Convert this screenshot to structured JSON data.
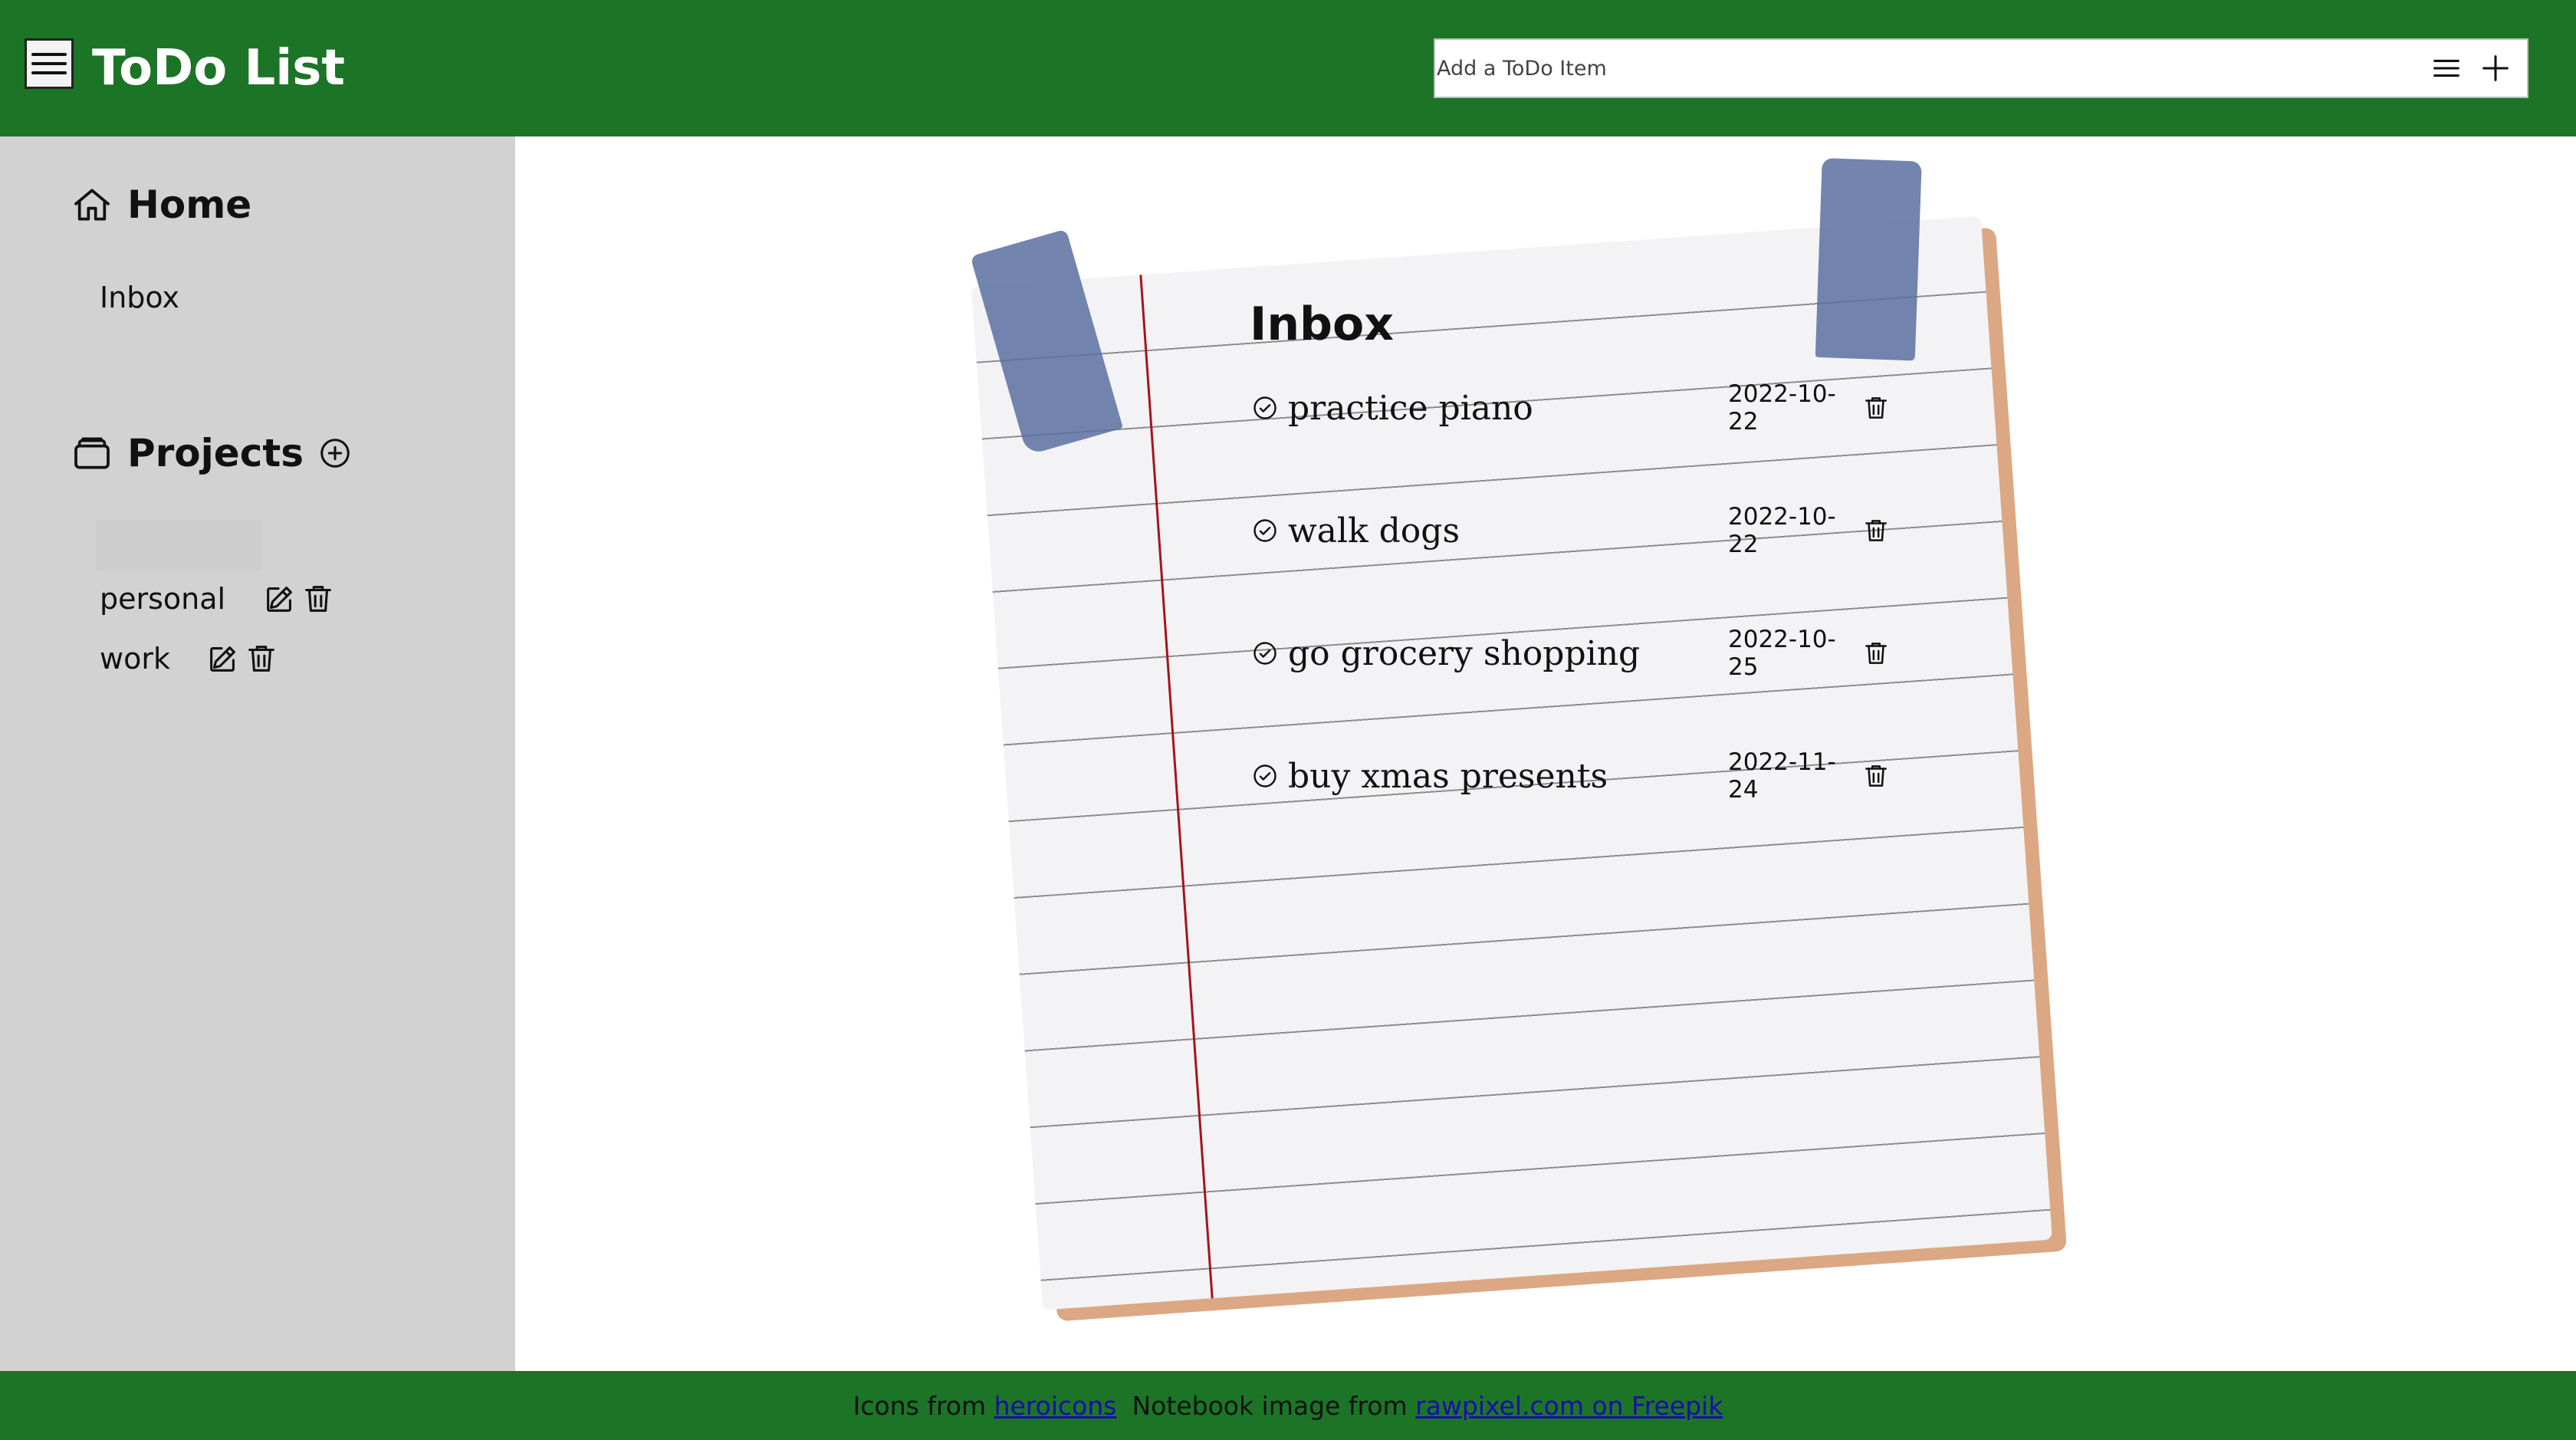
{
  "header": {
    "title": "ToDo List",
    "add_placeholder": "Add a ToDo Item"
  },
  "sidebar": {
    "home_label": "Home",
    "inbox_label": "Inbox",
    "projects_label": "Projects",
    "projects": [
      {
        "name": "personal"
      },
      {
        "name": "work"
      }
    ]
  },
  "main": {
    "list_title": "Inbox",
    "todos": [
      {
        "task": "practice piano",
        "date": "2022-10-22"
      },
      {
        "task": "walk dogs",
        "date": "2022-10-22"
      },
      {
        "task": "go grocery shopping",
        "date": "2022-10-25"
      },
      {
        "task": "buy xmas presents",
        "date": "2022-11-24"
      }
    ]
  },
  "footer": {
    "icons_prefix": "Icons from",
    "icons_link": "heroicons",
    "image_prefix": "Notebook image from",
    "image_link": "rawpixel.com on Freepik"
  },
  "colors": {
    "brand_green": "#1c7427",
    "sidebar_gray": "#d2d2d2",
    "paper_margin_red": "#a5141e",
    "tape_blue": "#6a7da8"
  }
}
